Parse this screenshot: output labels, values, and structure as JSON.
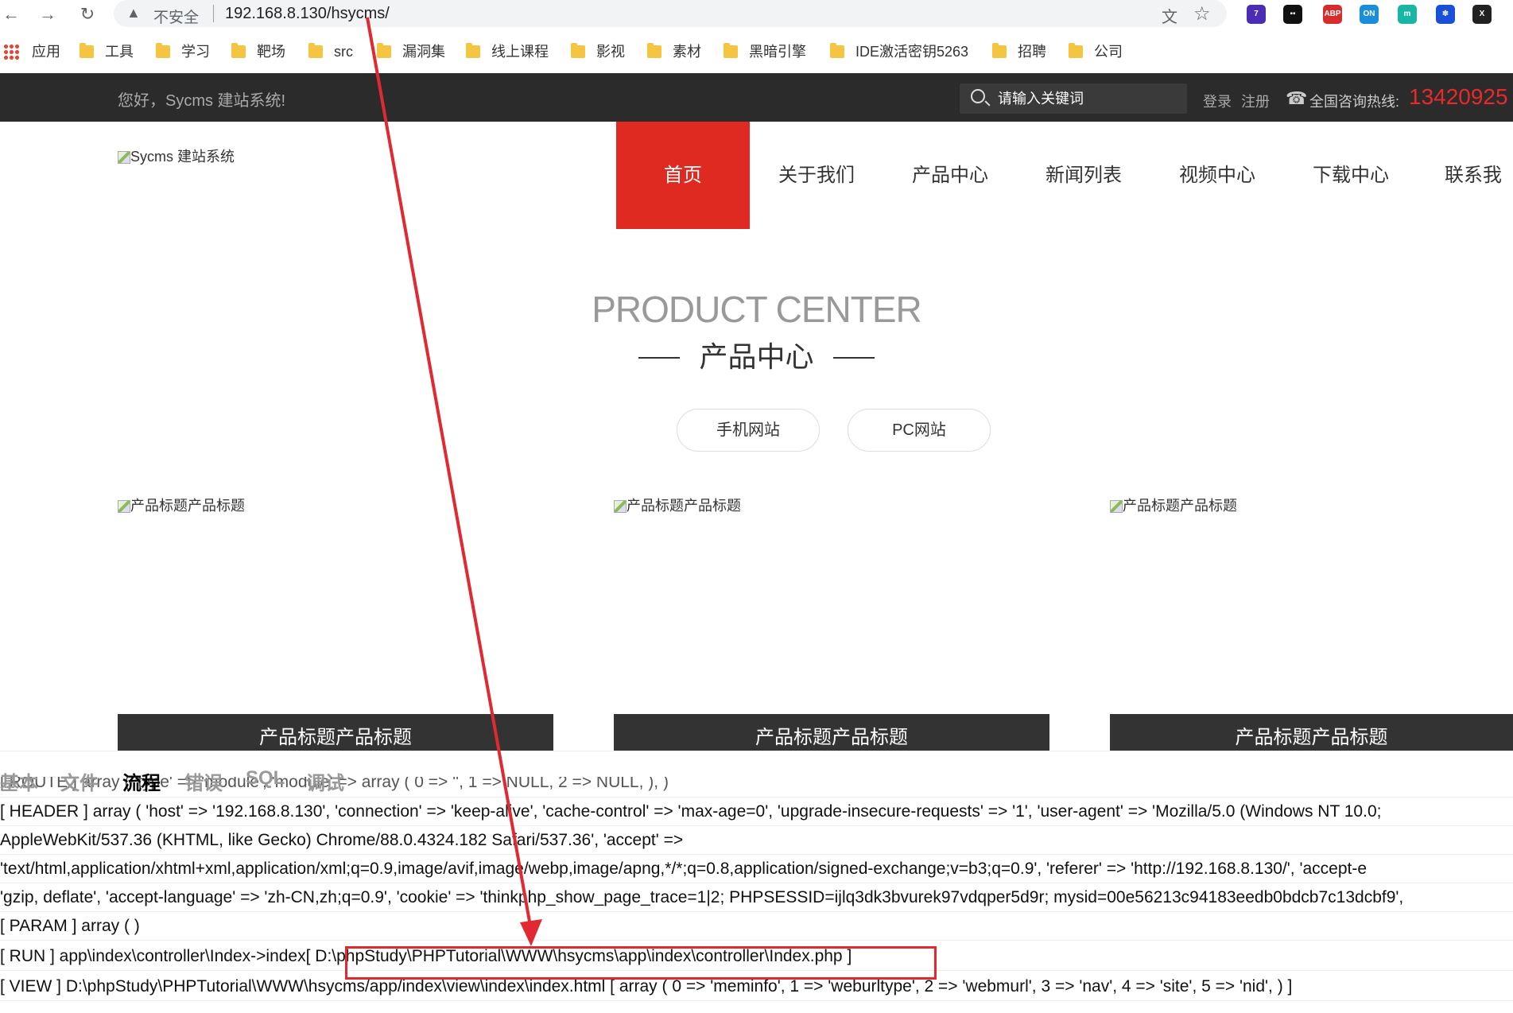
{
  "browser": {
    "insecure_label": "不安全",
    "url": "192.168.8.130/hsycms/",
    "bookmarks": [
      "应用",
      "工具",
      "学习",
      "靶场",
      "src",
      "漏洞集",
      "线上课程",
      "影视",
      "素材",
      "黑暗引擎",
      "IDE激活密钥5263",
      "招聘",
      "公司"
    ],
    "extensions": [
      {
        "name": "badge-7-extension",
        "label": "7",
        "color": "#4b2db5"
      },
      {
        "name": "ghost-extension",
        "label": "▪▪",
        "color": "#111111"
      },
      {
        "name": "abp-extension",
        "label": "ABP",
        "color": "#d62c2c"
      },
      {
        "name": "on-extension",
        "label": "ON",
        "color": "#1a8ed8"
      },
      {
        "name": "m-extension",
        "label": "m",
        "color": "#19b5a5"
      },
      {
        "name": "paw-extension",
        "label": "✽",
        "color": "#1a4fd8"
      },
      {
        "name": "x-extension",
        "label": "X",
        "color": "#222222"
      }
    ]
  },
  "site": {
    "greeting": "您好，Sycms 建站系统!",
    "search_placeholder": "请输入关键词",
    "login": "登录",
    "register": "注册",
    "hotline_label": "全国咨询热线:",
    "hotline_number": "13420925",
    "logo_alt": "Sycms 建站系统",
    "menu": [
      "首页",
      "关于我们",
      "产品中心",
      "新闻列表",
      "视频中心",
      "下载中心",
      "联系我们"
    ],
    "section_en": "PRODUCT CENTER",
    "section_cn": "产品中心",
    "pills": [
      "手机网站",
      "PC网站"
    ],
    "products": [
      {
        "img_alt": "产品标题产品标题",
        "title": "产品标题产品标题"
      },
      {
        "img_alt": "产品标题产品标题",
        "title": "产品标题产品标题"
      },
      {
        "img_alt": "产品标题产品标题",
        "title": "产品标题产品标题"
      }
    ]
  },
  "trace": {
    "tabs": [
      "基本",
      "文件",
      "流程",
      "错误",
      "SQL",
      "调试"
    ],
    "active_tab": "流程",
    "lines": [
      "[ ROUTE ] array ( 'type' => 'module', 'module' => array ( 0 => '', 1 => NULL, 2 => NULL, ), )",
      "[ HEADER ] array ( 'host' => '192.168.8.130', 'connection' => 'keep-alive', 'cache-control' => 'max-age=0', 'upgrade-insecure-requests' => '1', 'user-agent' => 'Mozilla/5.0 (Windows NT 10.0;",
      "AppleWebKit/537.36 (KHTML, like Gecko) Chrome/88.0.4324.182 Safari/537.36', 'accept' =>",
      "'text/html,application/xhtml+xml,application/xml;q=0.9,image/avif,image/webp,image/apng,*/*;q=0.8,application/signed-exchange;v=b3;q=0.9', 'referer' => 'http://192.168.8.130/', 'accept-e",
      "'gzip, deflate', 'accept-language' => 'zh-CN,zh;q=0.9', 'cookie' => 'thinkphp_show_page_trace=1|2; PHPSESSID=ijlq3dk3bvurek97vdqper5d9r; mysid=00e56213c94183eedb0bdcb7c13dcbf9',",
      "[ PARAM ] array ( )",
      "[ RUN ] app\\index\\controller\\Index->index[ D:\\phpStudy\\PHPTutorial\\WWW\\hsycms\\app\\index\\controller\\Index.php ]",
      "[ VIEW ] D:\\phpStudy\\PHPTutorial\\WWW\\hsycms/app/index\\view\\index\\index.html [ array ( 0 => 'meminfo', 1 => 'weburltype', 2 => 'webmurl', 3 => 'nav', 4 => 'site', 5 => 'nid', ) ]"
    ]
  },
  "colors": {
    "accent_red": "#df2a22",
    "annotation_red": "#e02a32",
    "topbar": "#2b2b2b"
  }
}
